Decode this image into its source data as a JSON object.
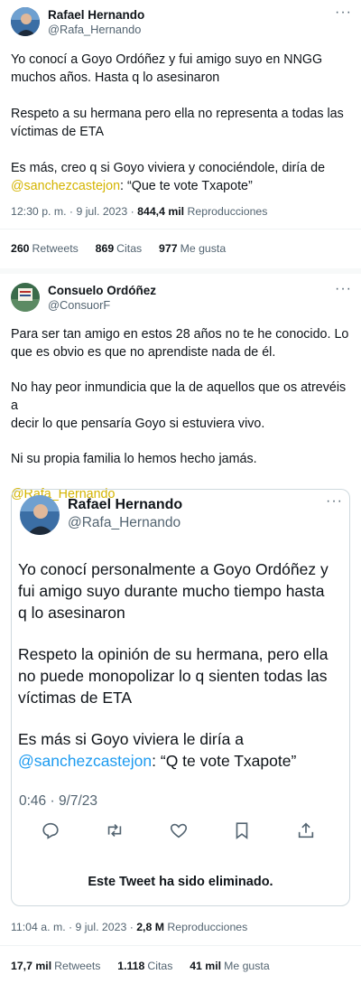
{
  "tweet1": {
    "name": "Rafael Hernando",
    "handle": "@Rafa_Hernando",
    "lines": [
      "Yo conocí a Goyo Ordóñez y fui amigo suyo en NNGG",
      "muchos años. Hasta q lo asesinaron",
      "Respeto a su hermana pero ella no representa a todas las",
      "víctimas de ETA",
      "Es más, creo q si Goyo viviera y conociéndole, diría de"
    ],
    "mention": "@sanchezcastejon",
    "quote_tail": ": “Que te vote Txapote”",
    "time": "12:30 p. m. · 9 jul. 2023 ·",
    "views": "844,4 mil",
    "views_label": "Reproducciones",
    "retweets": "260",
    "retweets_label": "Retweets",
    "quotes": "869",
    "quotes_label": "Citas",
    "likes": "977",
    "likes_label": "Me gusta"
  },
  "tweet2": {
    "name": "Consuelo Ordóñez",
    "handle": "@ConsuorF",
    "lines": [
      "Para ser tan amigo en estos 28 años no te he conocido. Lo",
      "que es obvio es que no aprendiste nada de él.",
      "No hay peor inmundicia que la de aquellos que os atrevéis a",
      "decir lo que pensaría Goyo si estuviera vivo.",
      "Ni su propia familia lo hemos hecho jamás."
    ],
    "mention": "@Rafa_Hernando",
    "time": "11:04 a. m. · 9 jul. 2023 ·",
    "views": "2,8 M",
    "views_label": "Reproducciones",
    "retweets": "17,7 mil",
    "retweets_label": "Retweets",
    "quotes": "1.118",
    "quotes_label": "Citas",
    "likes": "41 mil",
    "likes_label": "Me gusta"
  },
  "quoted": {
    "name": "Rafael Hernando",
    "handle": "@Rafa_Hernando",
    "lines": [
      "Yo conocí personalmente a Goyo Ordóñez y",
      "fui amigo suyo durante mucho tiempo hasta",
      "q lo asesinaron",
      "Respeto la opinión de su hermana, pero ella",
      "no puede monopolizar lo q sienten todas las",
      "víctimas de ETA",
      "Es más si Goyo viviera le diría a"
    ],
    "mention": "@sanchezcastejon",
    "quote_tail": ": “Q te vote Txapote”",
    "time": "0:46 · 9/7/23",
    "deleted": "Este Tweet ha sido eliminado."
  },
  "more_icon": "···",
  "icons": [
    "reply-icon",
    "retweet-icon",
    "like-icon",
    "bookmark-icon",
    "share-icon"
  ],
  "colors": {
    "mention_yellow": "#d4b400",
    "mention_blue": "#1d9bf0",
    "muted": "#536471"
  }
}
